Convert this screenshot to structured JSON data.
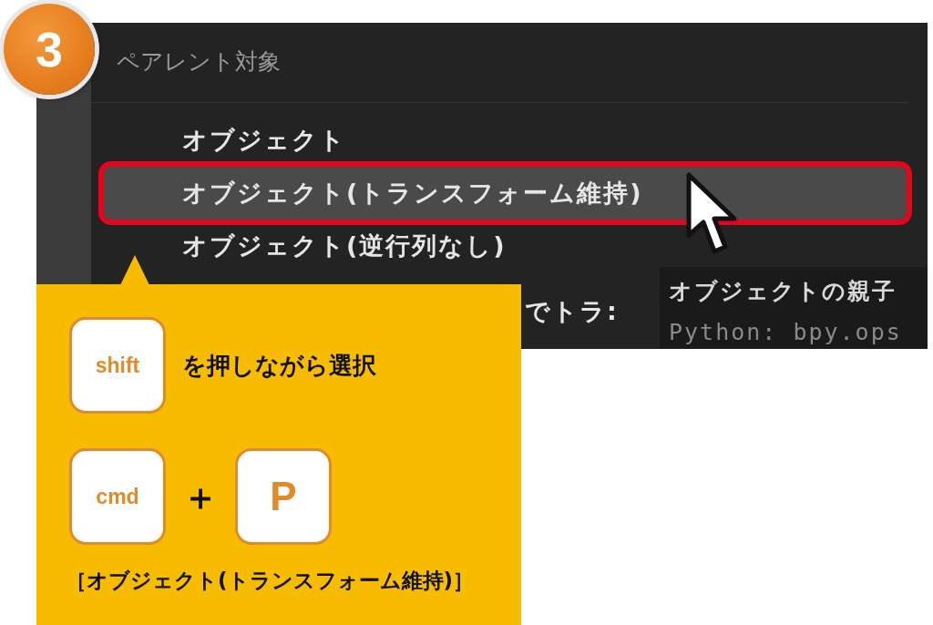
{
  "step_badge": "3",
  "menu": {
    "title": "ペアレント対象",
    "items": [
      {
        "label": "オブジェクト",
        "selected": false
      },
      {
        "label": "オブジェクト(トランスフォーム維持)",
        "selected": true
      },
      {
        "label": "オブジェクト(逆行列なし)",
        "selected": false
      },
      {
        "label": "でトラ:",
        "selected": false
      }
    ]
  },
  "tooltip": {
    "lines": [
      "オブジェクトの親子",
      "Python: bpy.ops"
    ]
  },
  "callout": {
    "rows": [
      {
        "keys": [
          "shift"
        ],
        "text": "を押しながら選択"
      },
      {
        "keys": [
          "cmd",
          "P"
        ],
        "joiner": "＋"
      }
    ],
    "caption": "［オブジェクト(トランスフォーム維持)］"
  }
}
